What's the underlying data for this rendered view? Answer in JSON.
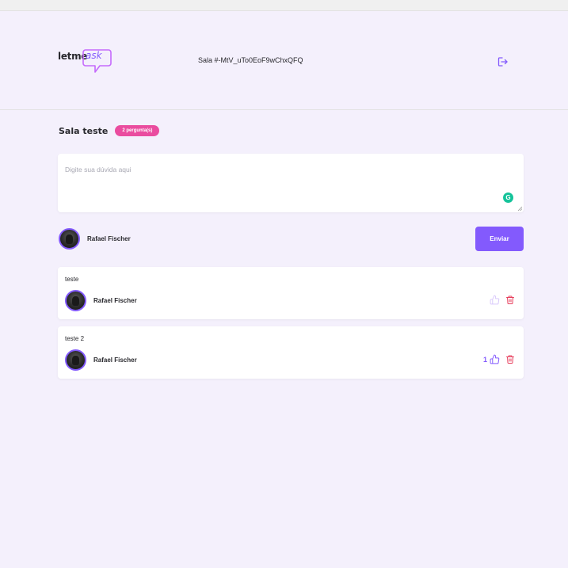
{
  "header": {
    "logo_text_dark": "letme",
    "logo_text_accent": "ask",
    "room_code": "Sala #-MtV_uTo0EoF9wChxQFQ",
    "logout_icon": "logout-icon"
  },
  "room": {
    "title": "Sala teste",
    "question_count_badge": "2 pergunta(s)"
  },
  "form": {
    "placeholder": "Digite sua dúvida aqui",
    "user_name": "Rafael Fischer",
    "send_label": "Enviar"
  },
  "questions": [
    {
      "content": "teste",
      "author": "Rafael Fischer",
      "like_count": "",
      "liked": false
    },
    {
      "content": "teste 2",
      "author": "Rafael Fischer",
      "like_count": "1",
      "liked": true
    }
  ],
  "colors": {
    "accent": "#835afd",
    "badge": "#ea4c9f",
    "delete": "#e73f5d",
    "background": "#f4f0fc"
  }
}
